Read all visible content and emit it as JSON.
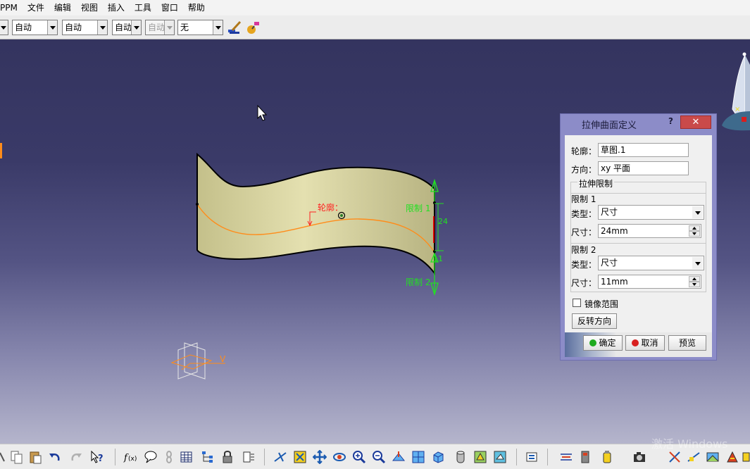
{
  "menu": [
    "PPM",
    "文件",
    "编辑",
    "视图",
    "插入",
    "工具",
    "窗口",
    "帮助"
  ],
  "toolbar": {
    "combo1": "自动",
    "combo2": "自动",
    "combo3": "自动",
    "combo4": "自动",
    "combo5": "无"
  },
  "viewport": {
    "profile_label": "轮廓：",
    "limit1_label": "限制 1",
    "limit2_label": "限制 2",
    "dim_value": "24",
    "dim2_value": "11",
    "axis_v_label": "V"
  },
  "dialog": {
    "title": "拉伸曲面定义",
    "help_label": "?",
    "close_label": "✕",
    "profile_label": "轮廓：",
    "profile_value": "草图.1",
    "direction_label": "方向：",
    "direction_value": "xy 平面",
    "extrude_limits_label": "拉伸限制",
    "limit1_header": "限制 1",
    "limit1_type_label": "类型：",
    "limit1_type_value": "尺寸",
    "limit1_dim_label": "尺寸：",
    "limit1_dim_value": "24mm",
    "limit2_header": "限制 2",
    "limit2_type_label": "类型：",
    "limit2_type_value": "尺寸",
    "limit2_dim_label": "尺寸：",
    "limit2_dim_value": "11mm",
    "mirror_label": "镜像范围",
    "reverse_label": "反转方向",
    "ok_label": "确定",
    "cancel_label": "取消",
    "preview_label": "预览"
  },
  "watermark": "激活 Windows",
  "colors": {
    "surface": "#d8d4a0",
    "limit_green": "#22e022",
    "profile_orange": "#ff8c1a",
    "profile_label_red": "#ff2020",
    "dialog_frame": "#8c8cc8",
    "close_red": "#c94a4a"
  }
}
